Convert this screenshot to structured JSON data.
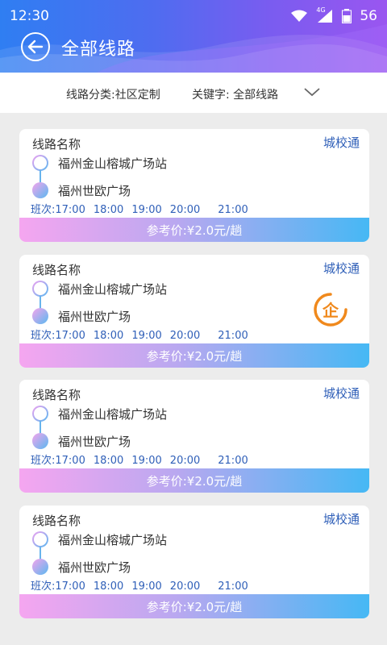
{
  "status": {
    "time": "12:30",
    "network": "4G",
    "battery": "56"
  },
  "header": {
    "title": "全部线路"
  },
  "filter": {
    "category": "线路分类:社区定制",
    "keyword": "关键字: 全部线路"
  },
  "colors": {
    "accent": "#2f5fb8",
    "corp_badge": "#f0891c"
  },
  "routes": [
    {
      "title": "线路名称",
      "badge": "城校通",
      "from": "福州金山榕城广场站",
      "to": "福州世欧广场",
      "schedule_label": "班次:17:00",
      "times": [
        "18:00",
        "19:00",
        "20:00",
        "21:00"
      ],
      "price": "参考价:¥2.0元/趟",
      "corp": ""
    },
    {
      "title": "线路名称",
      "badge": "城校通",
      "from": "福州金山榕城广场站",
      "to": "福州世欧广场",
      "schedule_label": "班次:17:00",
      "times": [
        "18:00",
        "19:00",
        "20:00",
        "21:00"
      ],
      "price": "参考价:¥2.0元/趟",
      "corp": "企"
    },
    {
      "title": "线路名称",
      "badge": "城校通",
      "from": "福州金山榕城广场站",
      "to": "福州世欧广场",
      "schedule_label": "班次:17:00",
      "times": [
        "18:00",
        "19:00",
        "20:00",
        "21:00"
      ],
      "price": "参考价:¥2.0元/趟",
      "corp": ""
    },
    {
      "title": "线路名称",
      "badge": "城校通",
      "from": "福州金山榕城广场站",
      "to": "福州世欧广场",
      "schedule_label": "班次:17:00",
      "times": [
        "18:00",
        "19:00",
        "20:00",
        "21:00"
      ],
      "price": "参考价:¥2.0元/趟",
      "corp": ""
    }
  ]
}
